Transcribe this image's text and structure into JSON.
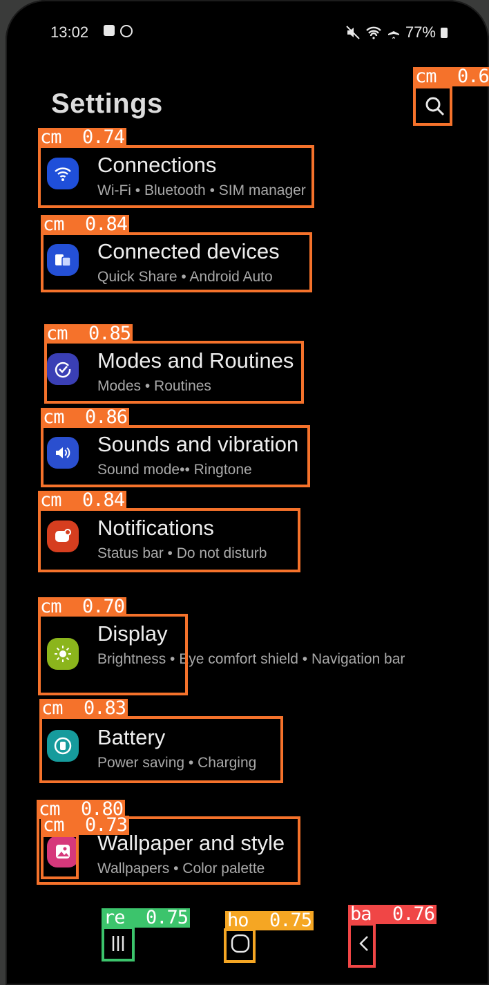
{
  "status_bar": {
    "time": "13:02",
    "battery": "77%",
    "icons": [
      "mute-icon",
      "wifi-icon",
      "airplane-icon",
      "battery-icon"
    ]
  },
  "page": {
    "title": "Settings"
  },
  "items": [
    {
      "label": "Connections",
      "sub": "Wi-Fi • Bluetooth • SIM manager",
      "icon": "wifi-icon",
      "color": "#1f4fd9"
    },
    {
      "label": "Connected devices",
      "sub": "Quick Share • Android Auto",
      "icon": "devices-icon",
      "color": "#2450d6"
    },
    {
      "label": "Modes and Routines",
      "sub": "Modes • Routines",
      "icon": "check-circle-icon",
      "color": "#3a3fb5"
    },
    {
      "label": "Sounds and vibration",
      "sub": "Sound mode•• Ringtone",
      "icon": "speaker-icon",
      "color": "#2a4fcf"
    },
    {
      "label": "Notifications",
      "sub": "Status bar • Do not disturb",
      "icon": "notification-icon",
      "color": "#d63e1f"
    },
    {
      "label": "Display",
      "sub": "Brightness • Eye comfort shield • Navigation bar",
      "icon": "sun-icon",
      "color": "#8bb51c"
    },
    {
      "label": "Battery",
      "sub": "Power saving • Charging",
      "icon": "battery-icon",
      "color": "#169b9c"
    },
    {
      "label": "Wallpaper and style",
      "sub": "Wallpapers • Color palette",
      "icon": "image-icon",
      "color": "#d6387b"
    }
  ],
  "detections": [
    {
      "tag": "cm  0.6"
    },
    {
      "tag": "cm  0.74"
    },
    {
      "tag": "cm  0.84"
    },
    {
      "tag": "cm  0.85"
    },
    {
      "tag": "cm  0.86"
    },
    {
      "tag": "cm  0.84"
    },
    {
      "tag": "cm  0.70"
    },
    {
      "tag": "cm  0.83"
    },
    {
      "tag": "cm  0.80"
    },
    {
      "tag": "cm  0.73"
    },
    {
      "tag": "re  0.75",
      "color": "#3cc46c"
    },
    {
      "tag": "ho  0.75",
      "color": "#f5a623"
    },
    {
      "tag": "ba  0.76",
      "color": "#f04646"
    }
  ],
  "nav": {
    "recents": "recents-icon",
    "home": "home-icon",
    "back": "back-icon"
  }
}
